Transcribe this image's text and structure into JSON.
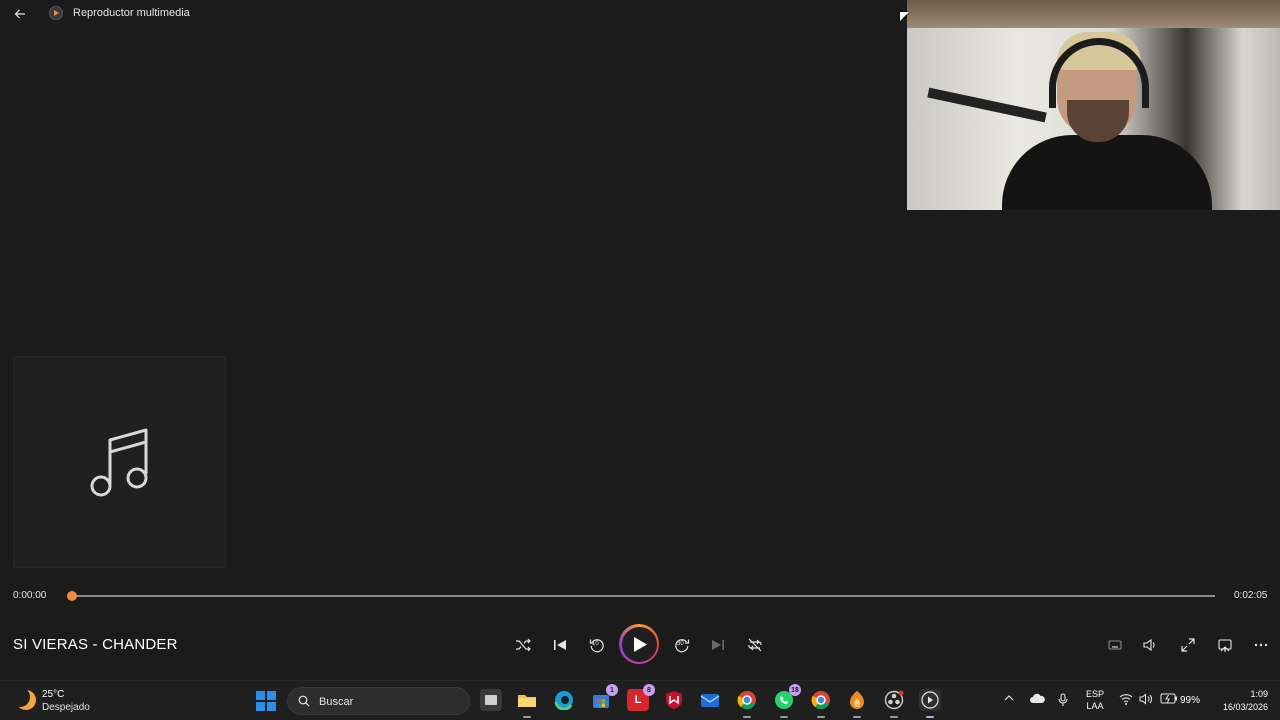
{
  "app": {
    "title": "Reproductor multimedia"
  },
  "player": {
    "current_time": "0:00:00",
    "total_time": "0:02:05",
    "progress_fraction": 0.0,
    "track_title": "SI VIERAS - CHANDER",
    "skip_back_seconds": "10",
    "skip_forward_seconds": "30",
    "accent_color": "#f08a44"
  },
  "taskbar": {
    "weather": {
      "temp": "25°C",
      "desc": "Despejado"
    },
    "search": {
      "placeholder": "Buscar"
    },
    "badges": {
      "store": "1",
      "lenovo": "8",
      "whatsapp": "18"
    },
    "language": {
      "line1": "ESP",
      "line2": "LAA"
    },
    "battery": "99%",
    "clock": {
      "time": "1:09",
      "date": "16/03/2026"
    }
  }
}
